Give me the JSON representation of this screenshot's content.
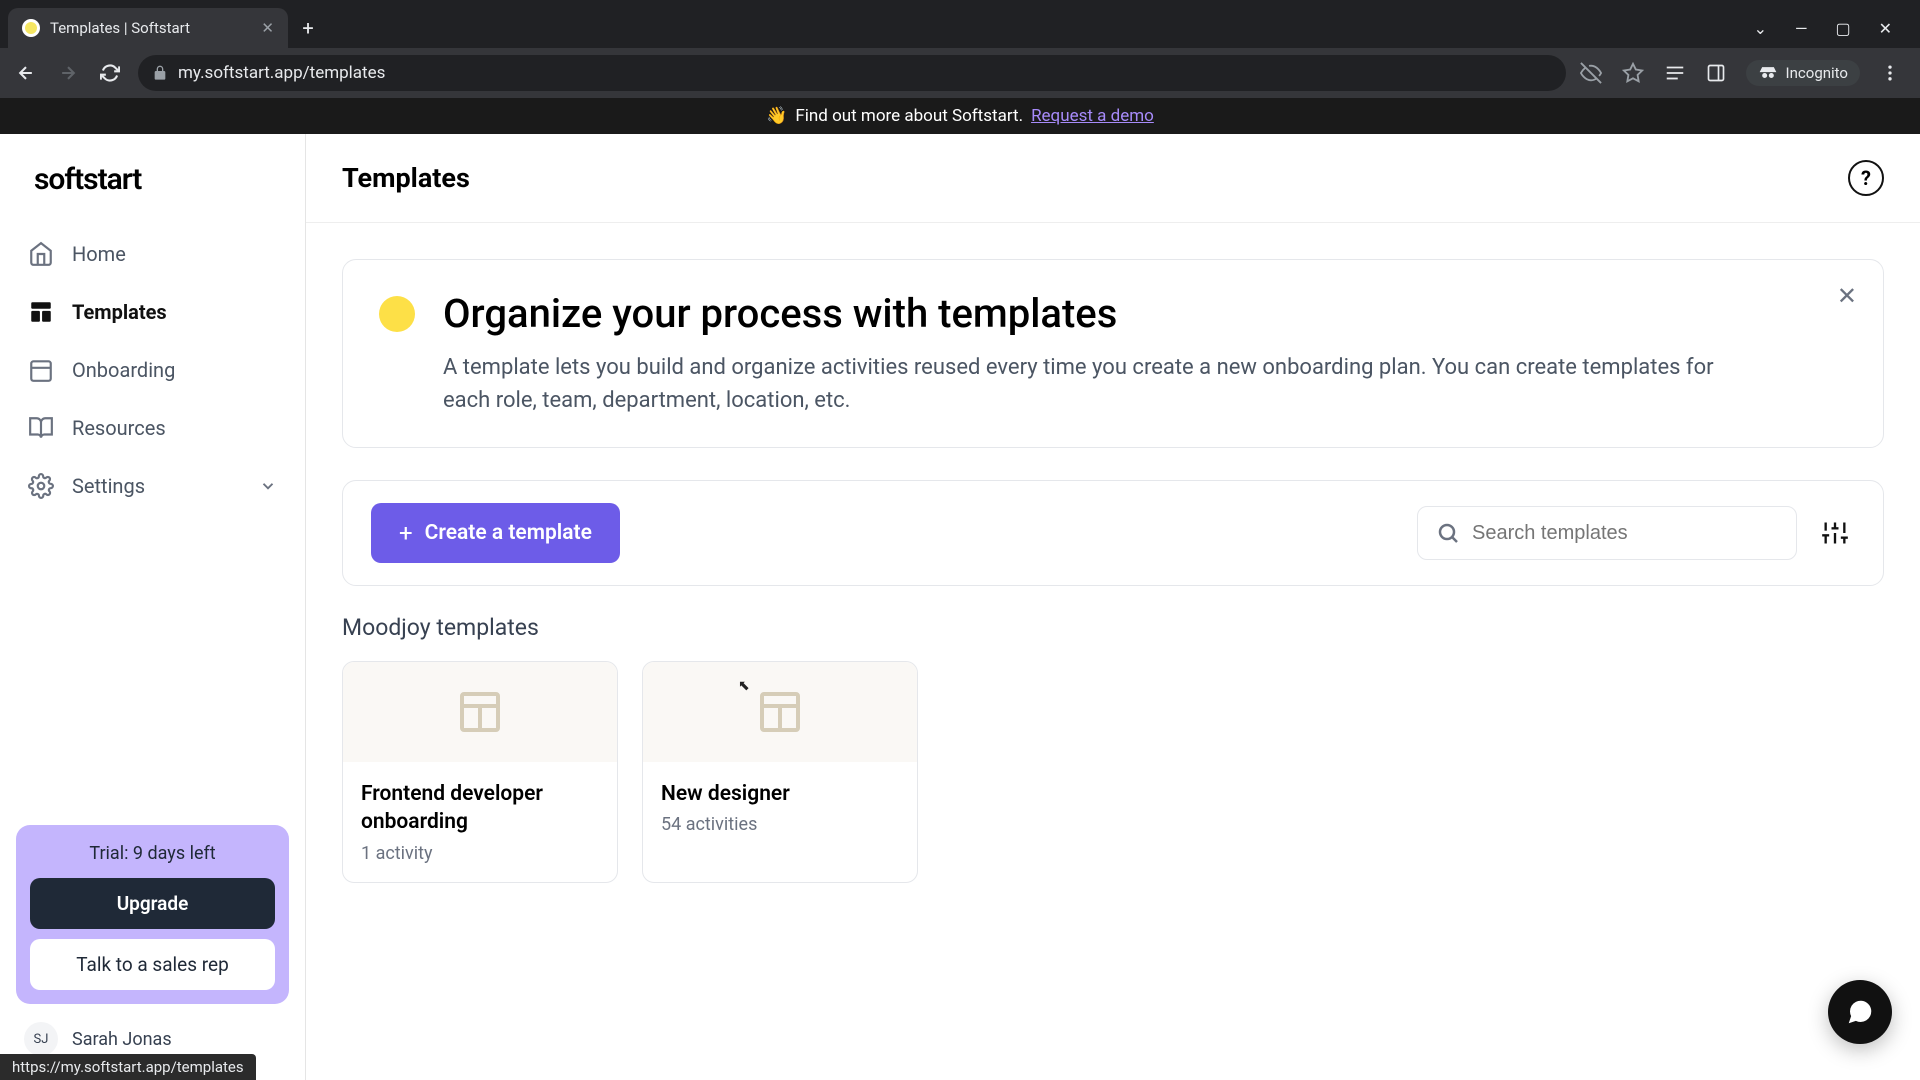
{
  "browser": {
    "tab_title": "Templates | Softstart",
    "url": "my.softstart.app/templates",
    "incognito_label": "Incognito"
  },
  "banner": {
    "emoji": "👋",
    "text": "Find out more about Softstart.",
    "link": "Request a demo"
  },
  "sidebar": {
    "logo": "softstart",
    "items": [
      {
        "label": "Home"
      },
      {
        "label": "Templates"
      },
      {
        "label": "Onboarding"
      },
      {
        "label": "Resources"
      },
      {
        "label": "Settings"
      }
    ],
    "trial": {
      "text": "Trial: 9 days left",
      "upgrade": "Upgrade",
      "sales": "Talk to a sales rep"
    },
    "user": {
      "initials": "SJ",
      "name": "Sarah Jonas"
    }
  },
  "header": {
    "title": "Templates"
  },
  "intro": {
    "title": "Organize your process with templates",
    "body": "A template lets you build and organize activities reused every time you create a new onboarding plan. You can create templates for each role, team, department, location, etc."
  },
  "toolbar": {
    "create": "Create a template",
    "search_placeholder": "Search templates"
  },
  "section": {
    "title": "Moodjoy templates"
  },
  "templates": [
    {
      "name": "Frontend developer onboarding",
      "meta": "1 activity"
    },
    {
      "name": "New designer",
      "meta": "54 activities"
    }
  ],
  "status_url": "https://my.softstart.app/templates"
}
